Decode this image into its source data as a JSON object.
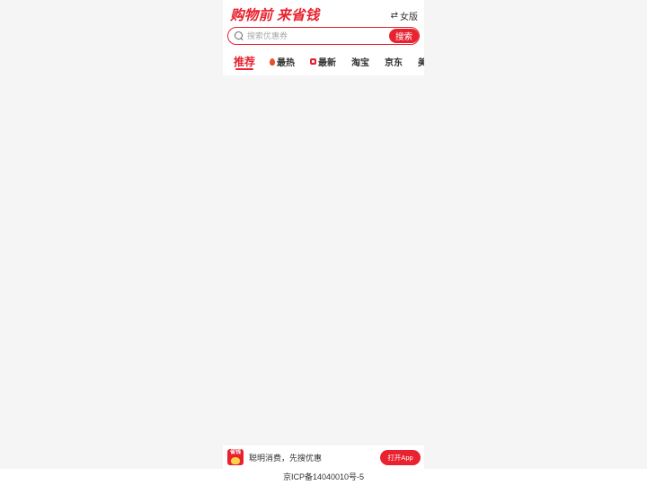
{
  "header": {
    "logo_text": "购物前 来省钱",
    "switch_label": "女版",
    "switch_icon": "swap-icon"
  },
  "search": {
    "placeholder": "搜索优惠券",
    "value": "",
    "button_label": "搜索"
  },
  "tabs": [
    {
      "label": "推荐",
      "active": true
    },
    {
      "label": "最热",
      "icon": "flame-icon"
    },
    {
      "label": "最新",
      "icon": "new-icon"
    },
    {
      "label": "淘宝"
    },
    {
      "label": "京东"
    },
    {
      "label": "美妆"
    }
  ],
  "bottom_bar": {
    "app_logo_text": "省钱",
    "slogan": "聪明消费，先搜优惠",
    "open_app_label": "打开App"
  },
  "footer": {
    "icp": "京ICP备14040010号-5"
  },
  "colors": {
    "accent": "#e8222f",
    "background": "#f5f5f5"
  }
}
